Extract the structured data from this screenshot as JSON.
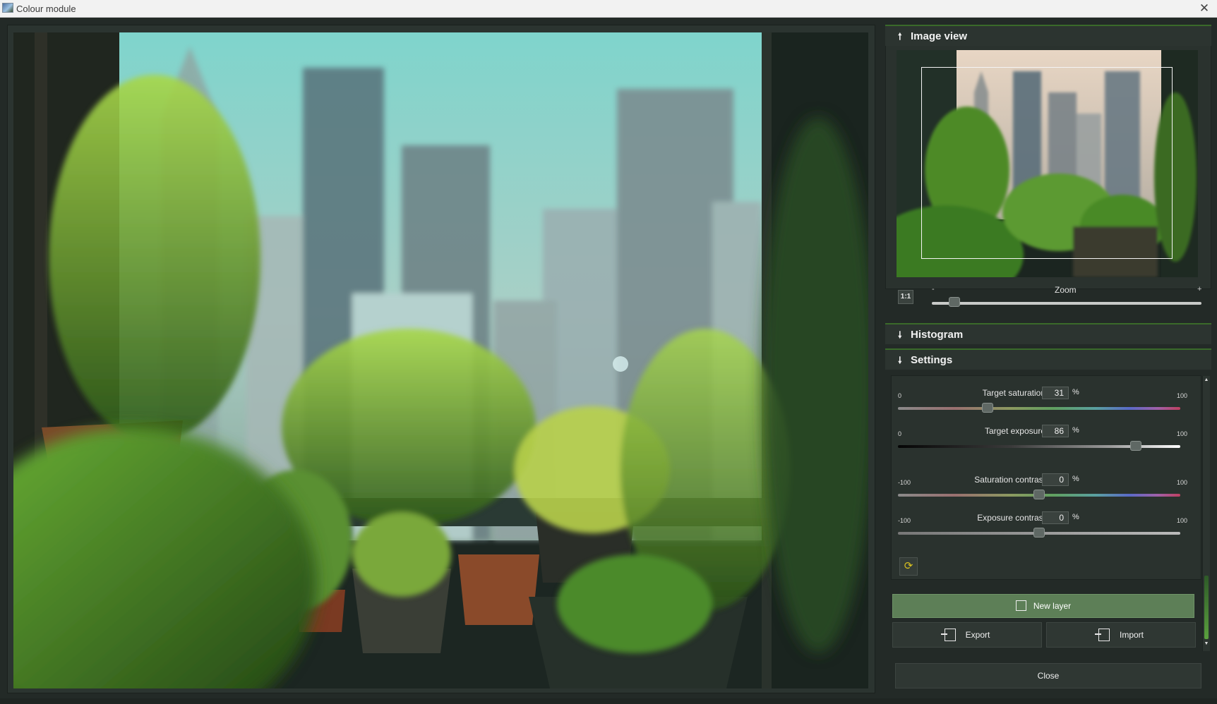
{
  "window": {
    "title": "Colour module",
    "close_glyph": "✕"
  },
  "image_view": {
    "header": "Image view",
    "collapse_glyph": "🠕",
    "zoom_label": "Zoom",
    "zoom_min": "-",
    "zoom_max": "+",
    "one_to_one": "1:1",
    "zoom_level": 0.07
  },
  "histogram": {
    "header": "Histogram",
    "expand_glyph": "🠗"
  },
  "settings": {
    "header": "Settings",
    "expand_glyph": "🠗",
    "sliders": [
      {
        "name": "Target saturation",
        "value": "31",
        "unit": "%",
        "min": "0",
        "max": "100"
      },
      {
        "name": "Target exposure",
        "value": "86",
        "unit": "%",
        "min": "0",
        "max": "100"
      },
      {
        "name": "Saturation contrast",
        "value": "0",
        "unit": "%",
        "min": "-100",
        "max": "100"
      },
      {
        "name": "Exposure contrast",
        "value": "0",
        "unit": "%",
        "min": "-100",
        "max": "100"
      }
    ],
    "reset_glyph": "⟳"
  },
  "actions": {
    "new_layer": "New layer",
    "export": "Export",
    "import": "Import",
    "close": "Close"
  },
  "colors": {
    "accent_green": "#5d7f57",
    "header_line": "#3a6a2a",
    "panel_bg": "#2a322e"
  }
}
